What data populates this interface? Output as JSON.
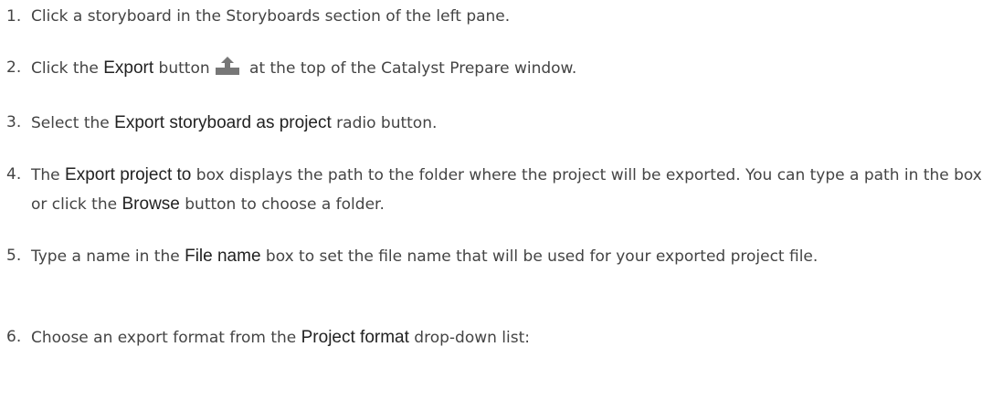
{
  "steps": [
    {
      "number": "1.",
      "parts": {
        "t1": "Click a storyboard in the Storyboards section of the left pane."
      }
    },
    {
      "number": "2.",
      "parts": {
        "t1": "Click the ",
        "ui1": "Export",
        "t2": " button",
        "icon": "export-icon",
        "t3": " at the top of the Catalyst Prepare window."
      }
    },
    {
      "number": "3.",
      "parts": {
        "t1": "Select the ",
        "ui1": "Export storyboard as project",
        "t2": " radio button."
      }
    },
    {
      "number": "4.",
      "parts": {
        "t1": "The ",
        "ui1": "Export project to",
        "t2": " box displays the path to the folder where the project will be exported. You can type a path in the box or click the ",
        "ui2": "Browse",
        "t3": " button to choose a folder."
      }
    },
    {
      "number": "5.",
      "parts": {
        "t1": "Type a name in the ",
        "ui1": "File name",
        "t2": " box to set the file name that will be used for your exported project file."
      }
    },
    {
      "number": "6.",
      "parts": {
        "t1": "Choose an export format from the ",
        "ui1": "Project format",
        "t2": " drop-down list:"
      }
    }
  ],
  "colors": {
    "text": "#444444",
    "ui_term": "#222222",
    "icon": "#777777"
  }
}
